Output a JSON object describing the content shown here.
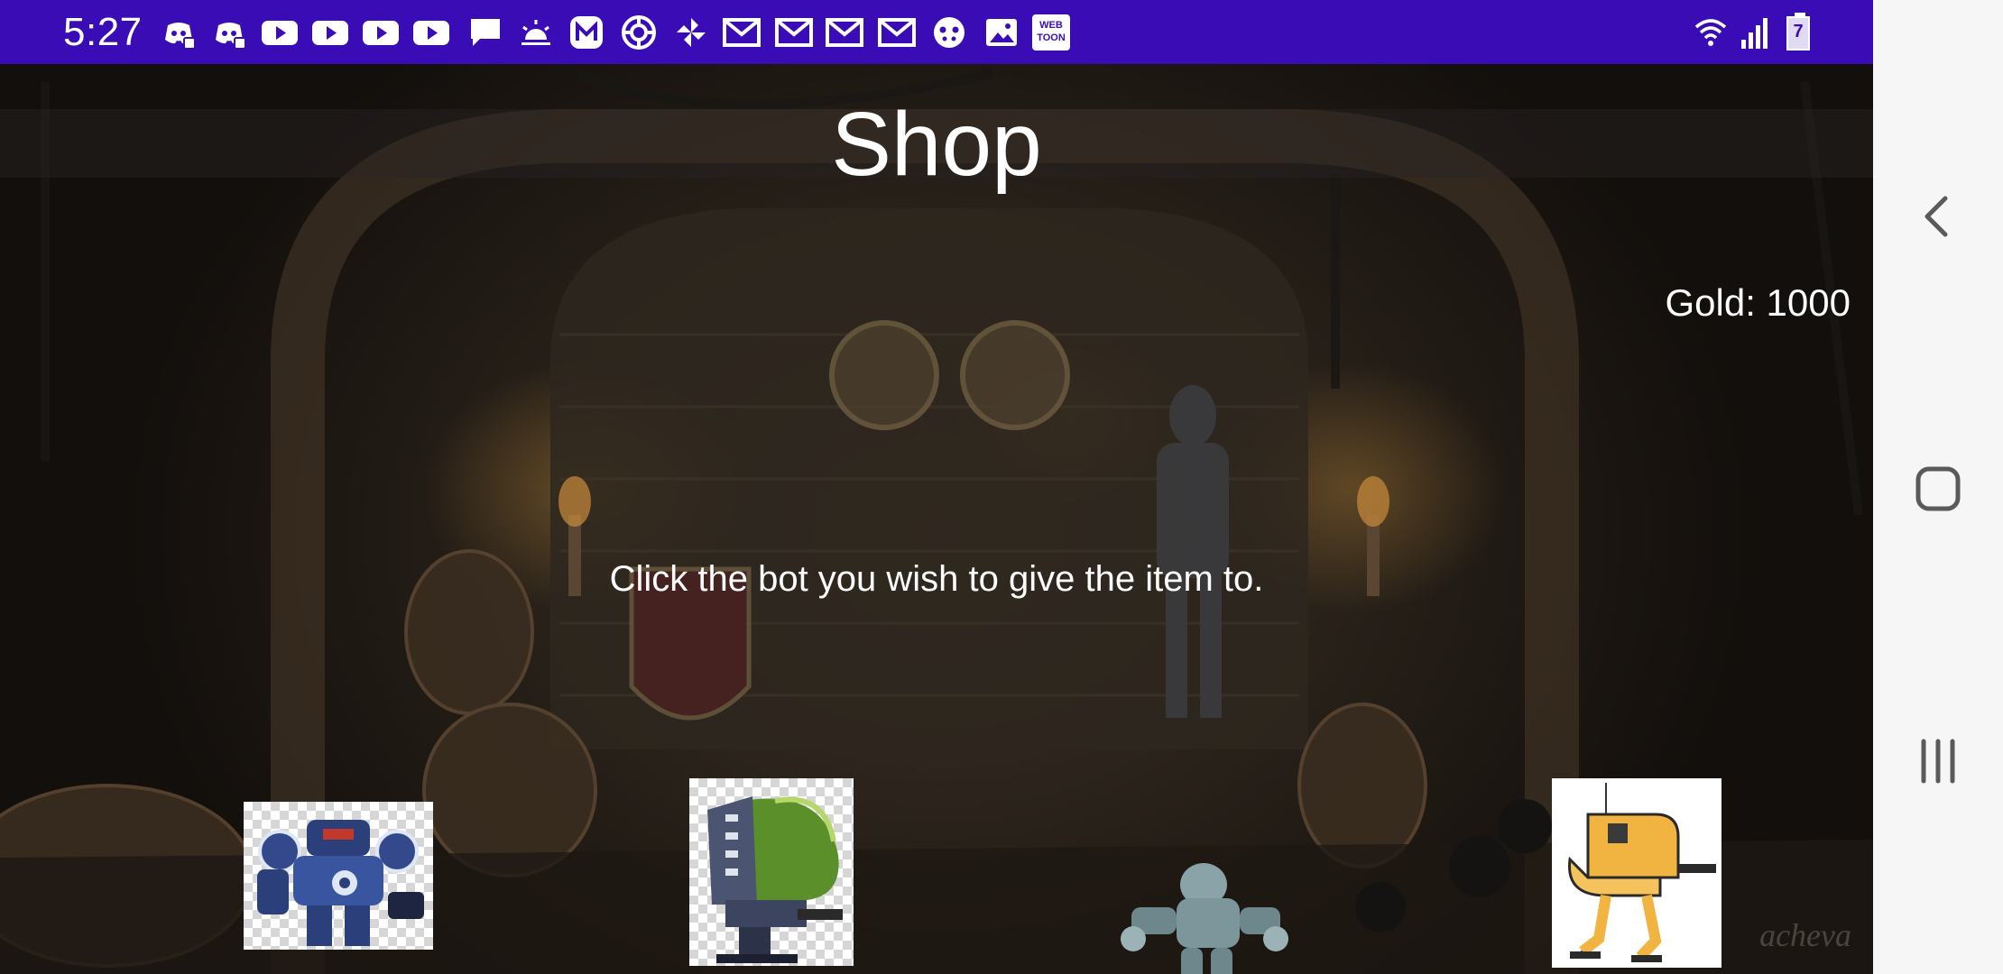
{
  "status_bar": {
    "time": "5:27",
    "notification_icons": [
      "discord-icon",
      "discord-icon",
      "youtube-icon",
      "youtube-icon",
      "youtube-icon",
      "youtube-icon",
      "message-icon",
      "weather-sunrise-icon",
      "m-app-icon",
      "target-app-icon",
      "pinwheel-icon",
      "gmail-icon",
      "gmail-icon",
      "gmail-icon",
      "gmail-icon",
      "game-icon",
      "gallery-icon",
      "webtoon-icon"
    ],
    "webtoon_label": "WEB TOON",
    "battery_level": "7"
  },
  "screen": {
    "title": "Shop",
    "gold_label": "Gold: 1000",
    "prompt": "Click the bot you wish to give the item to.",
    "watermark": "acheva"
  },
  "bots": [
    {
      "name": "blue-mech-bot"
    },
    {
      "name": "green-dome-bot"
    },
    {
      "name": "silver-robot-bot"
    },
    {
      "name": "yellow-walker-bot"
    }
  ],
  "colors": {
    "status_bar": "#3a0cb5",
    "nav_bar": "#f6f6f6",
    "text": "#ffffff"
  }
}
